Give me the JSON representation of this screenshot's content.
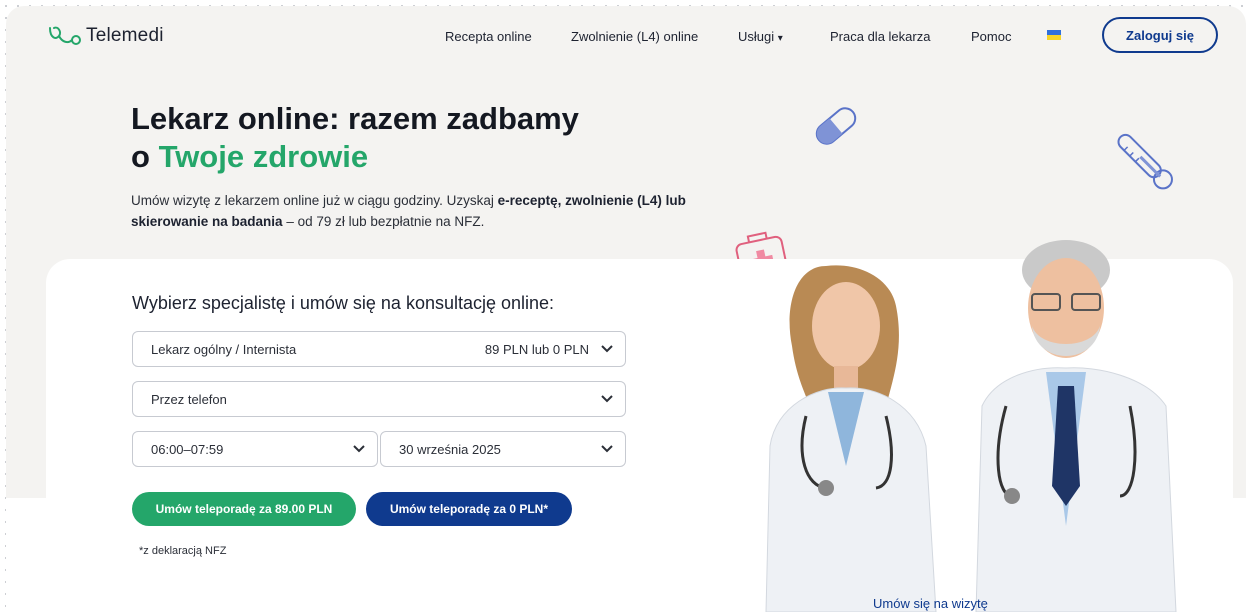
{
  "brand": {
    "name": "Telemedi"
  },
  "nav": {
    "items": [
      "Recepta online",
      "Zwolnienie (L4) online",
      "Usługi",
      "Praca dla lekarza",
      "Pomoc"
    ],
    "services_caret": "▾",
    "login_label": "Zaloguj się"
  },
  "hero": {
    "title_line1": "Lekarz online: razem zadbamy",
    "title_prefix": "o ",
    "title_highlight": "Twoje zdrowie",
    "lead_part1": "Umów wizytę z lekarzem online już w ciągu godziny. Uzyskaj ",
    "lead_bold1": "e-receptę, zwolnienie (L4) lub skierowanie na badania",
    "lead_part2": " – od 79 zł lub bezpłatnie na NFZ."
  },
  "booking": {
    "title": "Wybierz specjalistę i umów się na konsultację online:",
    "specialist": {
      "value": "Lekarz ogólny / Internista",
      "price": "89 PLN lub 0 PLN"
    },
    "channel": {
      "value": "Przez telefon"
    },
    "time": {
      "value": "06:00–07:59"
    },
    "date": {
      "value": "30 września 2025"
    },
    "paid_button": "Umów teleporadę za  89.00 PLN",
    "nfz_button": "Umów teleporadę za 0 PLN*",
    "note": "*z deklaracją NFZ"
  },
  "footer_link": "Umów się na wizytę",
  "colors": {
    "primary_green": "#24a66a",
    "primary_blue": "#0f3a8e",
    "background": "#f4f3f1"
  },
  "icons": [
    "logo-stethoscope-icon",
    "ukraine-flag-icon",
    "chevron-down-icon",
    "pill-icon",
    "thermometer-icon",
    "medical-kit-icon",
    "cross-icon"
  ]
}
